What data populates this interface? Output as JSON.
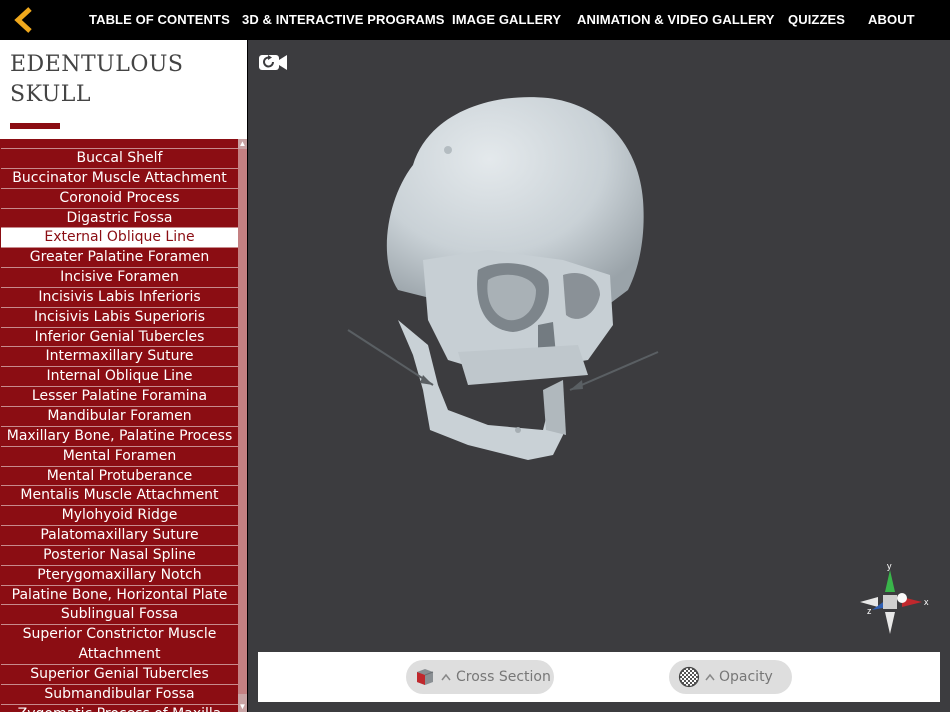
{
  "nav": {
    "items": [
      {
        "label": "TABLE OF CONTENTS"
      },
      {
        "label": "3D & INTERACTIVE PROGRAMS"
      },
      {
        "label": "IMAGE GALLERY"
      },
      {
        "label": "ANIMATION & VIDEO GALLERY"
      },
      {
        "label": "QUIZZES"
      },
      {
        "label": "ABOUT"
      }
    ],
    "back_icon": "chevron-left-icon",
    "accent": "#f0a81c"
  },
  "title": {
    "line1": "EDENTULOUS",
    "line2": "SKULL",
    "accent": "#8b0d13"
  },
  "structures": {
    "items": [
      {
        "label": "Buccal Shelf"
      },
      {
        "label": "Buccinator Muscle Attachment"
      },
      {
        "label": "Coronoid Process"
      },
      {
        "label": "Digastric Fossa"
      },
      {
        "label": "External Oblique Line"
      },
      {
        "label": "Greater Palatine Foramen"
      },
      {
        "label": "Incisive Foramen"
      },
      {
        "label": "Incisivis Labis Inferioris"
      },
      {
        "label": "Incisivis Labis Superioris"
      },
      {
        "label": "Inferior Genial Tubercles"
      },
      {
        "label": "Intermaxillary Suture"
      },
      {
        "label": "Internal Oblique Line"
      },
      {
        "label": "Lesser Palatine Foramina"
      },
      {
        "label": "Mandibular Foramen"
      },
      {
        "label": "Maxillary Bone, Palatine Process"
      },
      {
        "label": "Mental Foramen"
      },
      {
        "label": "Mental Protuberance"
      },
      {
        "label": "Mentalis Muscle Attachment"
      },
      {
        "label": "Mylohyoid Ridge"
      },
      {
        "label": "Palatomaxillary Suture"
      },
      {
        "label": "Posterior Nasal Spline"
      },
      {
        "label": "Pterygomaxillary Notch"
      },
      {
        "label": "Palatine Bone, Horizontal Plate"
      },
      {
        "label": "Sublingual Fossa"
      },
      {
        "label": "Superior Constrictor Muscle Attachment"
      },
      {
        "label": "Superior Genial Tubercles"
      },
      {
        "label": "Submandibular Fossa"
      },
      {
        "label": "Zygomatic Process of Maxilla"
      }
    ],
    "selected": "External Oblique Line",
    "list_color": "#8b0d13"
  },
  "viewer": {
    "camera_icon": "camera-reset-icon",
    "axes": {
      "x": "x",
      "y": "y",
      "z": "z"
    },
    "background": "#3c3c3f"
  },
  "controls": {
    "cross_section_label": "Cross Section",
    "opacity_label": "Opacity",
    "cross_section_icon": "cube-section-icon",
    "opacity_icon": "checker-sphere-icon",
    "expand_icon": "chevron-up-icon"
  }
}
